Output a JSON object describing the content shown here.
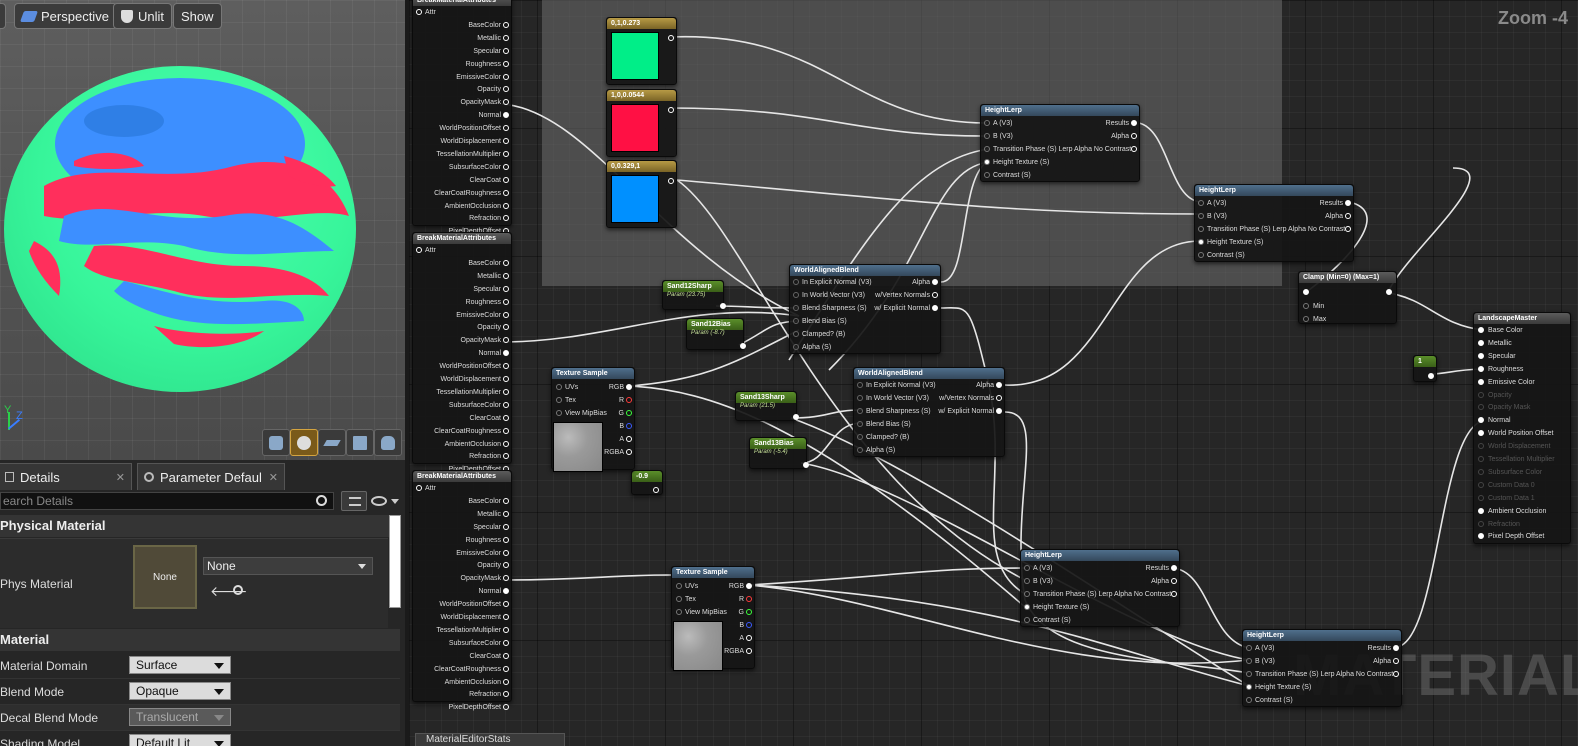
{
  "viewport": {
    "buttons": {
      "perspective": "Perspective",
      "unlit": "Unlit",
      "show": "Show"
    },
    "axis": {
      "y": "Y",
      "z": "Z"
    },
    "sphere_colors": {
      "base": "#37f59a",
      "blue": "#3d8fff",
      "red": "#ff2f5c"
    },
    "tools": [
      "cylinder-icon",
      "sphere-icon",
      "plane-icon",
      "cube-icon",
      "teapot-icon"
    ]
  },
  "details": {
    "tabs": {
      "details": "Details",
      "param": "Parameter Defaults"
    },
    "search_placeholder": "earch Details",
    "sections": {
      "physical": "Physical Material",
      "material": "Material"
    },
    "phys_material": {
      "label": "Phys Material",
      "thumb": "None",
      "value": "None"
    },
    "rows": {
      "domain": {
        "label": "Material Domain",
        "value": "Surface"
      },
      "blend": {
        "label": "Blend Mode",
        "value": "Opaque"
      },
      "decal": {
        "label": "Decal Blend Mode",
        "value": "Translucent"
      },
      "shading": {
        "label": "Shading Model",
        "value": "Default Lit"
      }
    }
  },
  "graph": {
    "zoom": "Zoom -4",
    "watermark": "MATERIAL",
    "status_tab": "MaterialEditorStats",
    "break_pins": [
      "Attr",
      "BaseColor",
      "Metallic",
      "Specular",
      "Roughness",
      "EmissiveColor",
      "Opacity",
      "OpacityMask",
      "Normal",
      "WorldPositionOffset",
      "WorldDisplacement",
      "TessellationMultiplier",
      "SubsurfaceColor",
      "ClearCoat",
      "ClearCoatRoughness",
      "AmbientOcclusion",
      "Refraction",
      "PixelDepthOffset"
    ],
    "break_title": "BreakMaterialAttributes",
    "colors": [
      {
        "label": "0,1,0.273",
        "hex": "#00ee88"
      },
      {
        "label": "1,0,0.0544",
        "hex": "#ff1044"
      },
      {
        "label": "0,0.329,1",
        "hex": "#0090ff"
      }
    ],
    "scalars": {
      "sand12sharp": {
        "title": "Sand12Sharp",
        "sub": "Param (23.75)"
      },
      "sand12bias": {
        "title": "Sand12Bias",
        "sub": "Param (-8.7)"
      },
      "sand13sharp": {
        "title": "Sand13Sharp",
        "sub": "Param (21.5)"
      },
      "sand13bias": {
        "title": "Sand13Bias",
        "sub": "Param (-5.4)"
      },
      "neg": "-0.9",
      "one": "1"
    },
    "texture": {
      "title": "Texture Sample",
      "inputs": [
        "UVs",
        "Tex",
        "View MipBias"
      ],
      "outputs": [
        "RGB",
        "R",
        "G",
        "B",
        "A",
        "RGBA"
      ]
    },
    "wab": {
      "title": "WorldAlignedBlend",
      "inputs": [
        "In Explicit Normal (V3)",
        "In World Vector (V3)",
        "Blend Sharpness (S)",
        "Blend Bias (S)",
        "Clamped? (B)",
        "Alpha (S)"
      ],
      "outputs": [
        "Alpha",
        "w/Vertex Normals",
        "w/ Explicit Normal"
      ]
    },
    "heightlerp": {
      "title": "HeightLerp",
      "inputs": [
        "A (V3)",
        "B (V3)",
        "Transition Phase (S) Lerp Alpha No Contrast",
        "Height Texture (S)",
        "Contrast (S)"
      ],
      "outputs": [
        "Results",
        "Alpha"
      ]
    },
    "clamp": {
      "title": "Clamp (Min=0) (Max=1)",
      "pins": [
        "Min",
        "Max"
      ]
    },
    "master": {
      "title": "LandscapeMaster",
      "pins": [
        "Base Color",
        "Metallic",
        "Specular",
        "Roughness",
        "Emissive Color",
        "Opacity",
        "Opacity Mask",
        "World Displacement",
        "Tessellation Multiplier",
        "Subsurface Color",
        "Custom Data 0",
        "Custom Data 1",
        "Ambient Occlusion",
        "Refraction",
        "Pixel Depth Offset"
      ],
      "normal": "Normal",
      "wpo": "World Position Offset"
    }
  }
}
